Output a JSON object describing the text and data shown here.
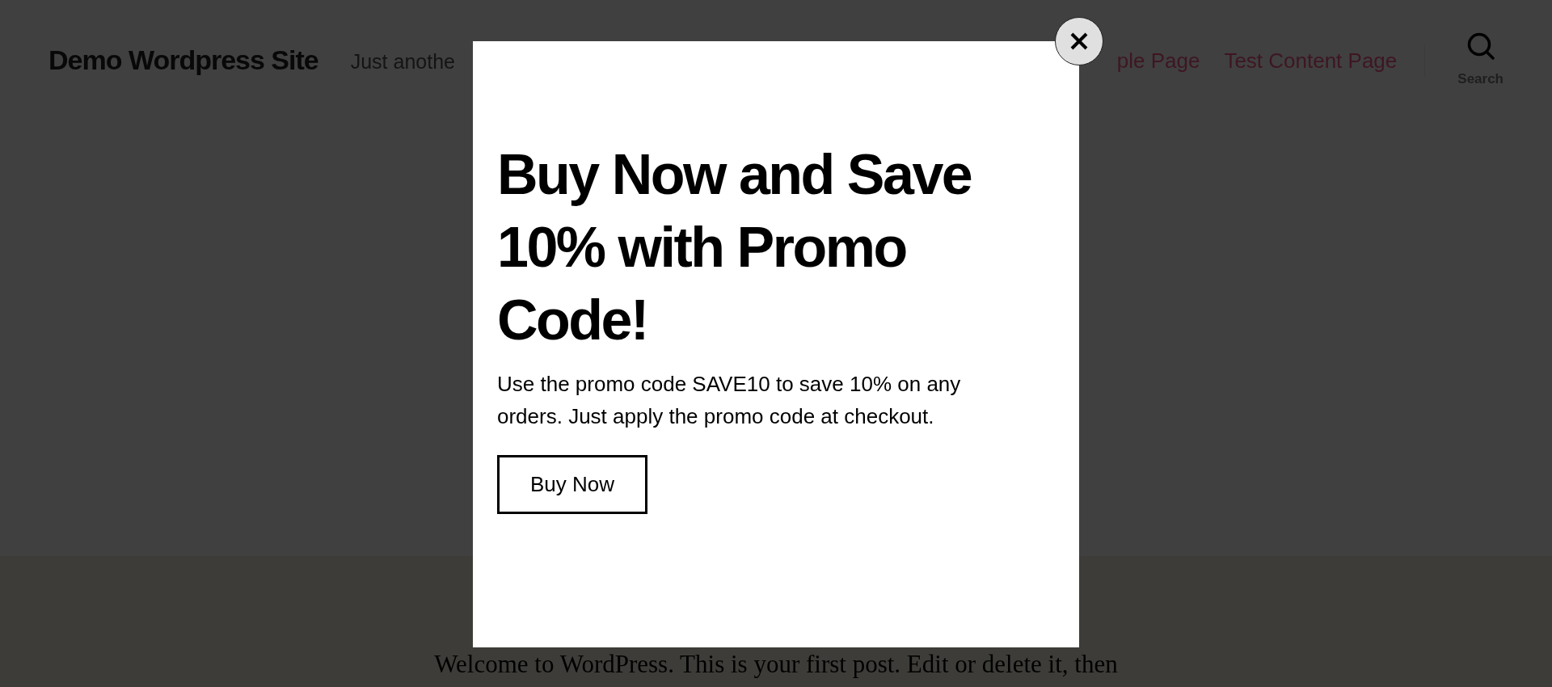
{
  "header": {
    "site_title": "Demo Wordpress Site",
    "tagline": "Just anothe",
    "nav": [
      {
        "label": "ple Page"
      },
      {
        "label": "Test Content Page"
      }
    ],
    "search_label": "Search"
  },
  "post": {
    "text": "Welcome to WordPress. This is your first post. Edit or delete it, then"
  },
  "popup": {
    "heading": "Buy Now and Save 10% with Promo Code!",
    "body": "Use the promo code SAVE10 to save 10% on any orders. Just apply the promo code at checkout.",
    "button": "Buy Now"
  }
}
